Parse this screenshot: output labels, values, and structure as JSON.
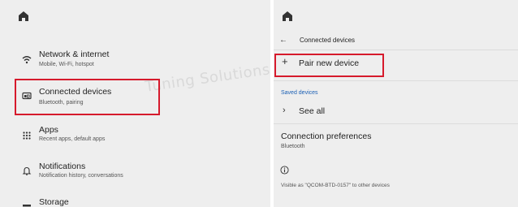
{
  "left": {
    "items": [
      {
        "title": "Network & internet",
        "subtitle": "Mobile, Wi-Fi, hotspot",
        "icon": "wifi-icon"
      },
      {
        "title": "Connected devices",
        "subtitle": "Bluetooth, pairing",
        "icon": "connected-devices-icon"
      },
      {
        "title": "Apps",
        "subtitle": "Recent apps, default apps",
        "icon": "apps-grid-icon"
      },
      {
        "title": "Notifications",
        "subtitle": "Notification history, conversations",
        "icon": "bell-icon"
      },
      {
        "title": "Storage",
        "subtitle": "",
        "icon": "storage-icon"
      }
    ],
    "watermark": "Tuning Solutions"
  },
  "right": {
    "header_title": "Connected devices",
    "pair_label": "Pair new device",
    "saved_section": "Saved devices",
    "see_all_label": "See all",
    "connection_prefs_title": "Connection preferences",
    "connection_prefs_sub": "Bluetooth",
    "visible_as": "Visible as \"QCOM-BTD-0157\" to other devices"
  },
  "colors": {
    "highlight": "#d61a2c",
    "panel_bg": "#eeeeee",
    "section_blue": "#1a5fb4"
  }
}
